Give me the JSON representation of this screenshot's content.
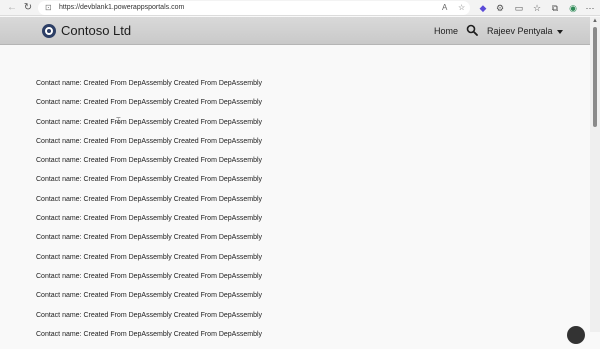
{
  "browser": {
    "url": "https://devblank1.powerappsportals.com"
  },
  "header": {
    "brand": "Contoso Ltd",
    "home": "Home",
    "user": "Rajeev Pentyala"
  },
  "contacts": [
    "Contact name: Created From DepAssembly Created From DepAssembly",
    "Contact name: Created From DepAssembly Created From DepAssembly",
    "Contact name: Created From DepAssembly Created From DepAssembly",
    "Contact name: Created From DepAssembly Created From DepAssembly",
    "Contact name: Created From DepAssembly Created From DepAssembly",
    "Contact name: Created From DepAssembly Created From DepAssembly",
    "Contact name: Created From DepAssembly Created From DepAssembly",
    "Contact name: Created From DepAssembly Created From DepAssembly",
    "Contact name: Created From DepAssembly Created From DepAssembly",
    "Contact name: Created From DepAssembly Created From DepAssembly",
    "Contact name: Created From DepAssembly Created From DepAssembly",
    "Contact name: Created From DepAssembly Created From DepAssembly",
    "Contact name: Created From DepAssembly Created From DepAssembly",
    "Contact name: Created From DepAssembly Created From DepAssembly"
  ]
}
